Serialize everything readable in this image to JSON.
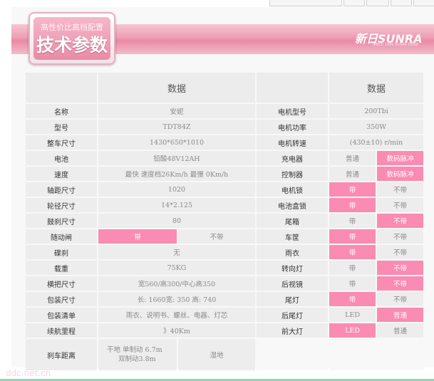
{
  "banner": {
    "badge_subtitle": "高性价比高档配置",
    "badge_title": "技术参数",
    "brand": "新日SUNRA",
    "brand_sub": "SINCE 1999 SUNRA EBIKE"
  },
  "headers": {
    "left_value": "数据",
    "right_value": "数据"
  },
  "rows": [
    {
      "label": "名称",
      "value": "安妮",
      "value_b": "",
      "value_split": false,
      "value_hl": false,
      "value_b_hl": false,
      "r_label": "电机型号",
      "r_a": "200Tbi",
      "r_b": "",
      "r_split": false,
      "r_a_hl": false,
      "r_b_hl": false
    },
    {
      "label": "型号",
      "value": "TDT84Z",
      "value_b": "",
      "value_split": false,
      "value_hl": false,
      "value_b_hl": false,
      "r_label": "电机功率",
      "r_a": "350W",
      "r_b": "",
      "r_split": false,
      "r_a_hl": false,
      "r_b_hl": false
    },
    {
      "label": "整车尺寸",
      "value": "1430*650*1010",
      "value_b": "",
      "value_split": false,
      "value_hl": false,
      "value_b_hl": false,
      "r_label": "电机转速",
      "r_a": "(430±10) r/min",
      "r_b": "",
      "r_split": false,
      "r_a_hl": false,
      "r_b_hl": false
    },
    {
      "label": "电池",
      "value": "铅酸48V12AH",
      "value_b": "",
      "value_split": false,
      "value_hl": false,
      "value_b_hl": false,
      "r_label": "充电器",
      "r_a": "普通",
      "r_b": "数码脉冲",
      "r_split": true,
      "r_a_hl": false,
      "r_b_hl": true
    },
    {
      "label": "速度",
      "value": "最快 速度档26Km/h   最慢 0Km/h",
      "value_b": "",
      "value_split": false,
      "value_hl": false,
      "value_b_hl": false,
      "r_label": "控制器",
      "r_a": "普通",
      "r_b": "数码脉冲",
      "r_split": true,
      "r_a_hl": false,
      "r_b_hl": true
    },
    {
      "label": "轴距尺寸",
      "value": "1020",
      "value_b": "",
      "value_split": false,
      "value_hl": false,
      "value_b_hl": false,
      "r_label": "电机锁",
      "r_a": "带",
      "r_b": "不带",
      "r_split": true,
      "r_a_hl": true,
      "r_b_hl": false
    },
    {
      "label": "轮径尺寸",
      "value": "14*2.125",
      "value_b": "",
      "value_split": false,
      "value_hl": false,
      "value_b_hl": false,
      "r_label": "电池盒锁",
      "r_a": "带",
      "r_b": "不带",
      "r_split": true,
      "r_a_hl": true,
      "r_b_hl": false
    },
    {
      "label": "鼓刹尺寸",
      "value": "80",
      "value_b": "",
      "value_split": false,
      "value_hl": false,
      "value_b_hl": false,
      "r_label": "尾箱",
      "r_a": "带",
      "r_b": "不带",
      "r_split": true,
      "r_a_hl": false,
      "r_b_hl": true
    },
    {
      "label": "随动闸",
      "value": "带",
      "value_b": "不带",
      "value_split": true,
      "value_hl": true,
      "value_b_hl": false,
      "r_label": "车筐",
      "r_a": "带",
      "r_b": "不带",
      "r_split": true,
      "r_a_hl": true,
      "r_b_hl": false
    },
    {
      "label": "碟刹",
      "value": "无",
      "value_b": "",
      "value_split": false,
      "value_hl": false,
      "value_b_hl": false,
      "r_label": "雨衣",
      "r_a": "带",
      "r_b": "不带",
      "r_split": true,
      "r_a_hl": true,
      "r_b_hl": false
    },
    {
      "label": "载重",
      "value": "75KG",
      "value_b": "",
      "value_split": false,
      "value_hl": false,
      "value_b_hl": false,
      "r_label": "转向灯",
      "r_a": "带",
      "r_b": "不带",
      "r_split": true,
      "r_a_hl": false,
      "r_b_hl": true
    },
    {
      "label": "横把尺寸",
      "value": "宽560/高300/中心高350",
      "value_b": "",
      "value_split": false,
      "value_hl": false,
      "value_b_hl": false,
      "r_label": "后视镜",
      "r_a": "带",
      "r_b": "不带",
      "r_split": true,
      "r_a_hl": false,
      "r_b_hl": true
    },
    {
      "label": "包装尺寸",
      "value": "长: 1660宽: 350  高: 740",
      "value_b": "",
      "value_split": false,
      "value_hl": false,
      "value_b_hl": false,
      "r_label": "尾灯",
      "r_a": "带",
      "r_b": "不带",
      "r_split": true,
      "r_a_hl": true,
      "r_b_hl": false
    },
    {
      "label": "包装清单",
      "value": "雨衣、说明书、螺丝、电器、灯芯",
      "value_b": "",
      "value_split": false,
      "value_hl": false,
      "value_b_hl": false,
      "r_label": "后尾灯",
      "r_a": "LED",
      "r_b": "普通",
      "r_split": true,
      "r_a_hl": false,
      "r_b_hl": true
    },
    {
      "label": "续航里程",
      "value": "》40Km",
      "value_b": "",
      "value_split": false,
      "value_hl": false,
      "value_b_hl": false,
      "r_label": "前大灯",
      "r_a": "LED",
      "r_b": "普通",
      "r_split": true,
      "r_a_hl": true,
      "r_b_hl": false
    }
  ],
  "brake_row": {
    "label": "刹车距离",
    "line1": "干地 单制动 6.7m",
    "line2": "双制动3.8m",
    "value_b": "湿地"
  },
  "footer_note": "ddc.net.cn",
  "colors": {
    "highlight": "#fa8bb2",
    "cell": "#ededed",
    "banner": "#e98aa5"
  }
}
